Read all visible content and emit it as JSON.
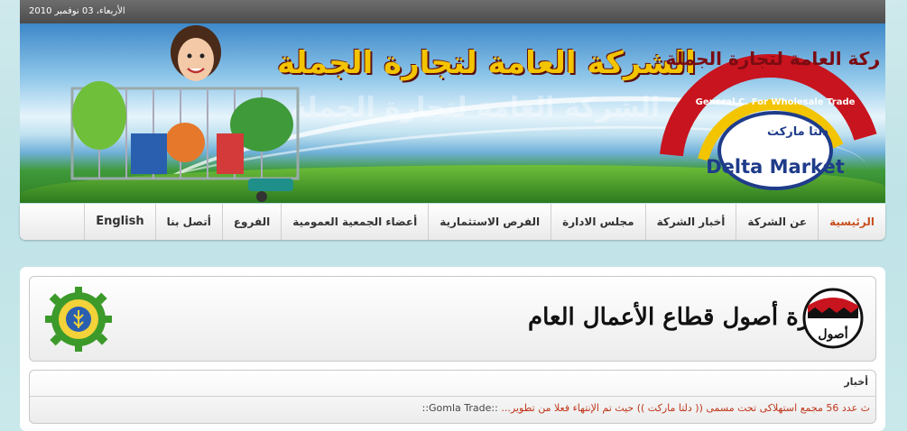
{
  "topbar": {
    "date": "الأربعاء، 03 نوفمبر 2010"
  },
  "banner": {
    "headline": "الشركة العامة لتجارة الجملة",
    "logo_arabic": "الشركة العامة لتجارة الجملة",
    "logo_english": "General C. For Wholesale Trade",
    "brand": "Delta Market",
    "brand_arabic": "دلتا ماركت"
  },
  "nav": {
    "items": [
      {
        "label": "الرئيسية",
        "active": true
      },
      {
        "label": "عن الشركة"
      },
      {
        "label": "أخبار الشركة"
      },
      {
        "label": "مجلس الادارة"
      },
      {
        "label": "الفرص الاستثمارية"
      },
      {
        "label": "أعضاء الجمعية العمومية"
      },
      {
        "label": "الفروع"
      },
      {
        "label": "أتصل بنا"
      },
      {
        "label": "English"
      }
    ]
  },
  "holding": {
    "title": "إدارة أصول قطاع الأعمال العام",
    "logo_word": "أصول"
  },
  "news": {
    "heading": "أخبار",
    "ticker": "ث عدد 56 مجمع استهلاكى تحت مسمى (( دلتا ماركت )) حيث تم الإنتهاء فعلا من تطوير...",
    "source": "::Gomla Trade::"
  },
  "colors": {
    "accent": "#c8501e",
    "ticker": "#c0361a",
    "headline": "#f3c400"
  }
}
